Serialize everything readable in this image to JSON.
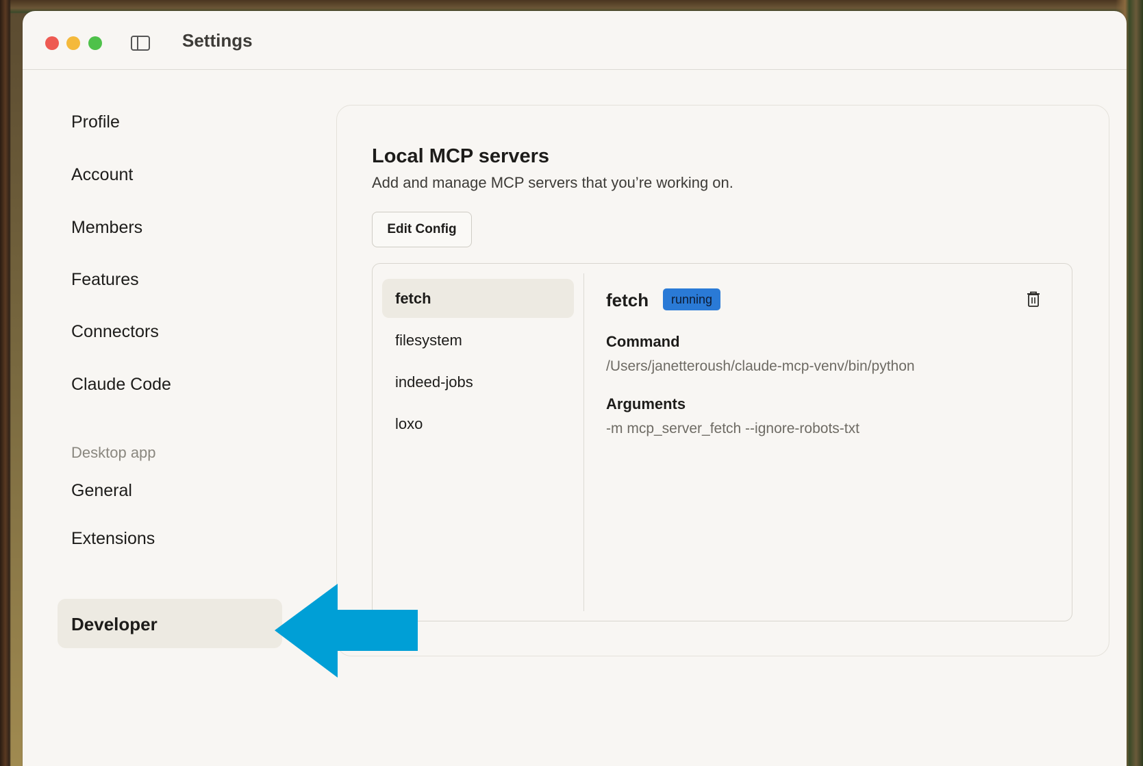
{
  "window": {
    "title": "Settings"
  },
  "sidebar": {
    "items": [
      {
        "label": "Profile"
      },
      {
        "label": "Account"
      },
      {
        "label": "Members"
      },
      {
        "label": "Features"
      },
      {
        "label": "Connectors"
      },
      {
        "label": "Claude Code"
      }
    ],
    "section_heading": "Desktop app",
    "desktop_items": [
      {
        "label": "General"
      },
      {
        "label": "Extensions"
      },
      {
        "label": "Developer",
        "active": true
      }
    ]
  },
  "main": {
    "title": "Local MCP servers",
    "subtitle": "Add and manage MCP servers that you’re working on.",
    "edit_config_label": "Edit Config",
    "servers": [
      {
        "name": "fetch",
        "active": true
      },
      {
        "name": "filesystem"
      },
      {
        "name": "indeed-jobs"
      },
      {
        "name": "loxo"
      }
    ],
    "detail": {
      "name": "fetch",
      "status": "running",
      "command_label": "Command",
      "command_value": "/Users/janetteroush/claude-mcp-venv/bin/python",
      "arguments_label": "Arguments",
      "arguments_value": "-m mcp_server_fetch --ignore-robots-txt"
    }
  },
  "colors": {
    "accent_badge": "#2a7ad6",
    "annotation_arrow": "#009fd6",
    "active_bg": "#edeae2"
  },
  "icons": [
    "sidebar-toggle-icon",
    "trash-icon",
    "annotation-arrow"
  ]
}
